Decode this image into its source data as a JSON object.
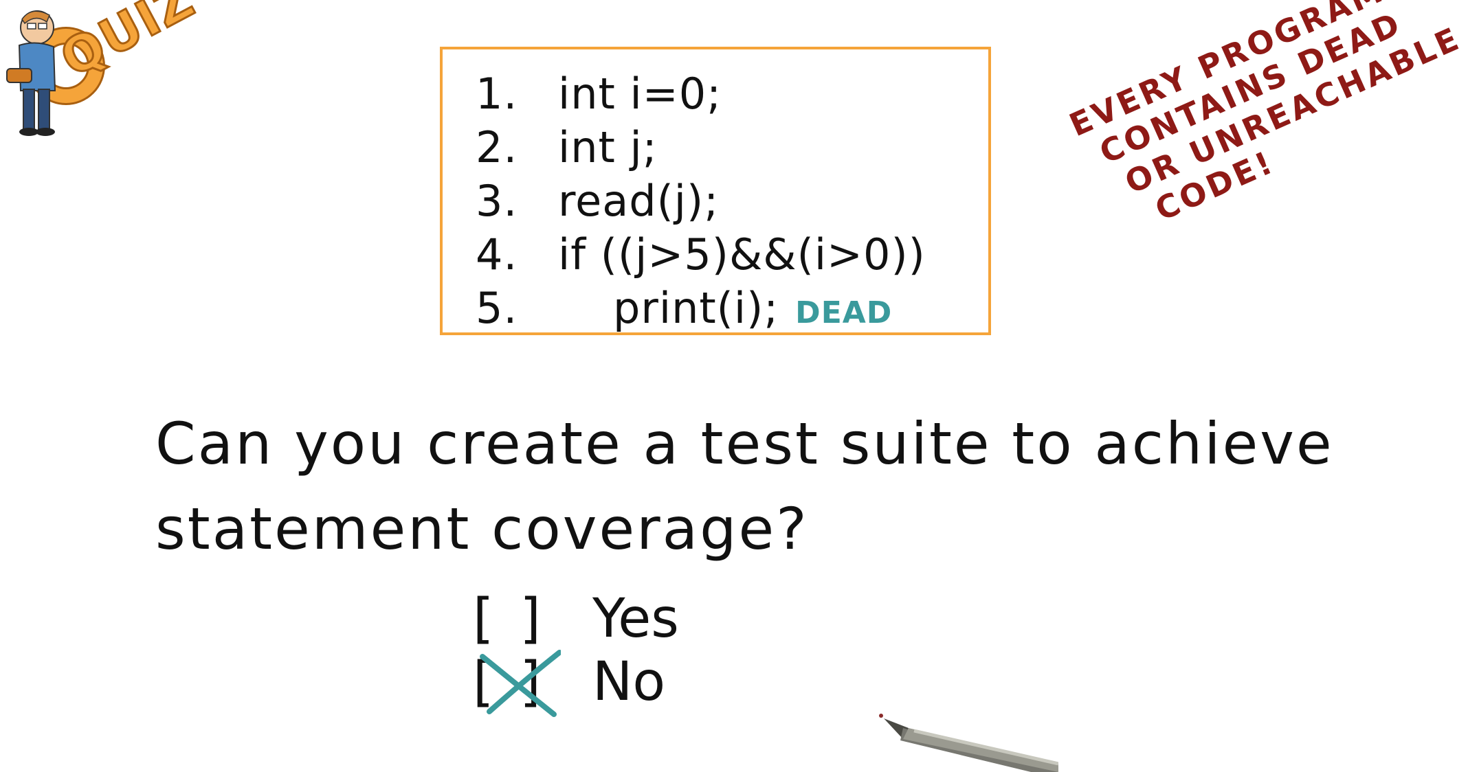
{
  "quiz_logo": {
    "word": "QUIZ",
    "colors": {
      "fill": "#f5a43a",
      "outline": "#a85f10"
    }
  },
  "code_box": {
    "border_color": "#f5a43a",
    "lines": [
      {
        "num": "1.",
        "code": "int i=0;"
      },
      {
        "num": "2.",
        "code": "int j;"
      },
      {
        "num": "3.",
        "code": "read(j);"
      },
      {
        "num": "4.",
        "code": "if ((j>5)&&(i>0))"
      },
      {
        "num": "5.",
        "code": "print(i);"
      }
    ],
    "dead_label": "DEAD",
    "dead_color": "#3a9a9c"
  },
  "note": {
    "lines": [
      "EVERY PROGRAM",
      "CONTAINS DEAD",
      "OR UNREACHABLE",
      "CODE!"
    ],
    "color": "#8e1a16"
  },
  "question": {
    "line1": "Can you create a test suite to achieve",
    "line2": "statement coverage?"
  },
  "options": [
    {
      "label": "Yes",
      "checked": false
    },
    {
      "label": "No",
      "checked": true
    }
  ],
  "check_color": "#3a9a9c",
  "icons": {
    "mascot": "quiz-mascot-icon",
    "pen": "pen-icon",
    "check": "x-mark-icon"
  }
}
